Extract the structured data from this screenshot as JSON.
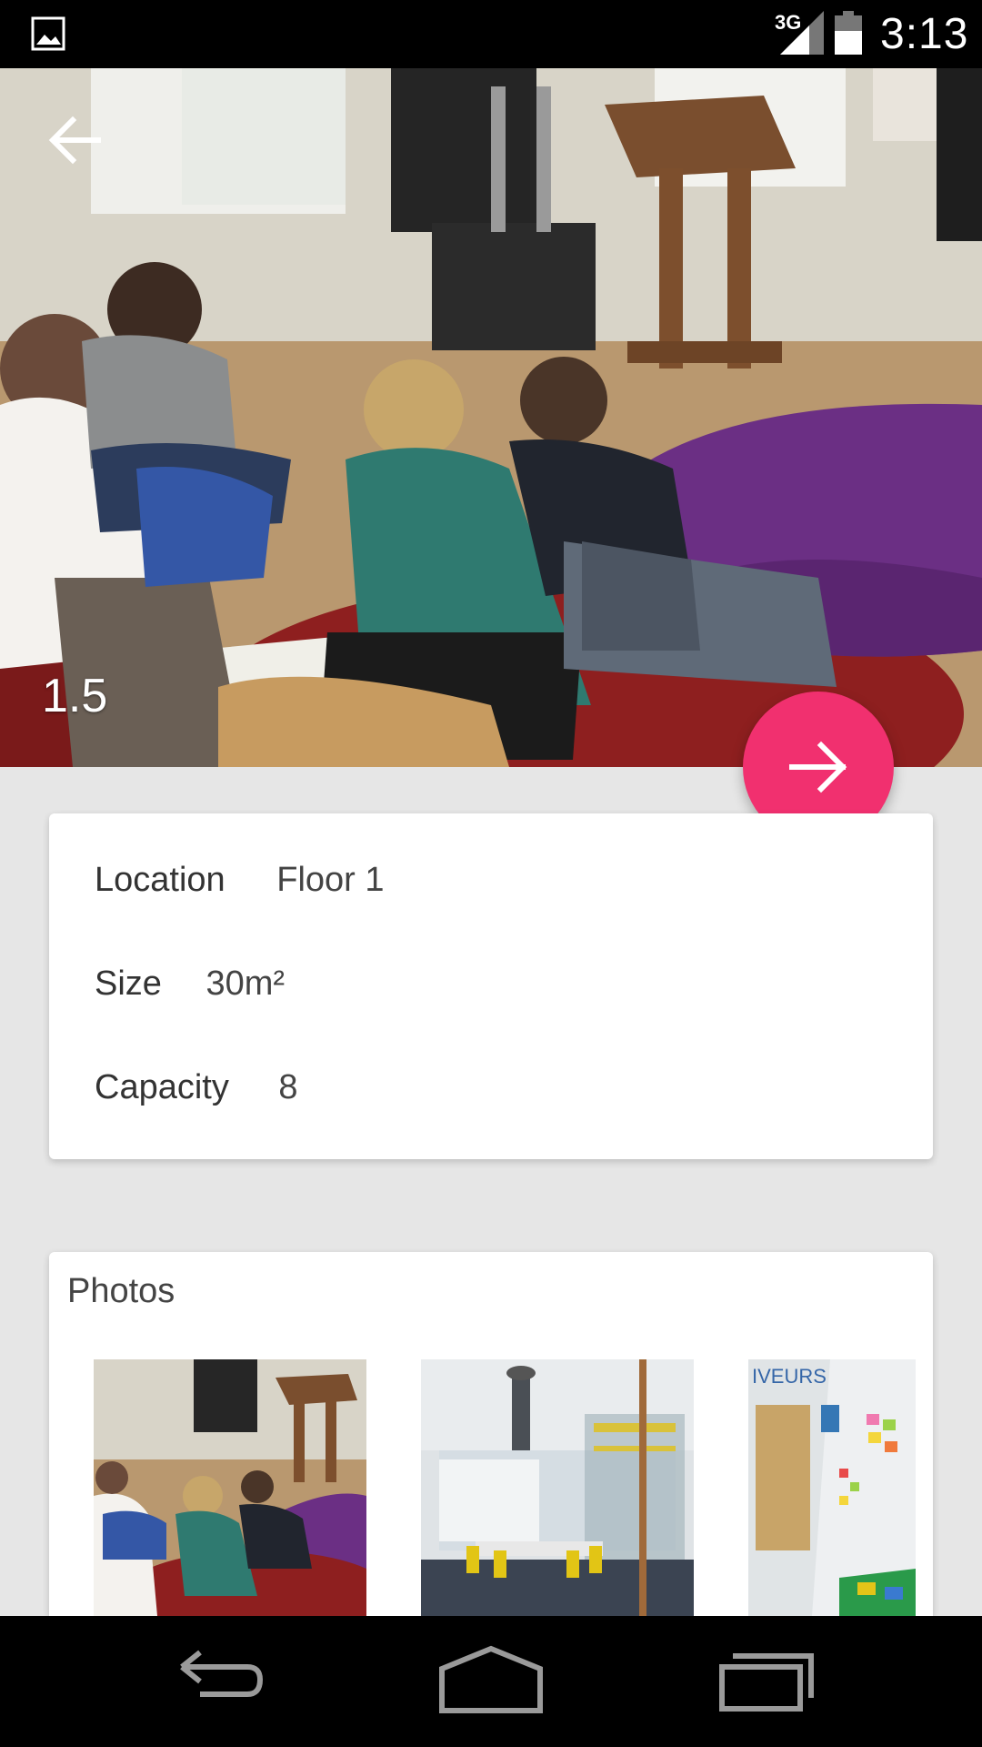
{
  "status_bar": {
    "network": "3G",
    "time": "3:13",
    "icons": [
      "gallery-icon",
      "signal-icon",
      "battery-icon"
    ]
  },
  "hero": {
    "rating": "1.5",
    "back_icon": "arrow-left-icon",
    "fab_icon": "arrow-right-icon",
    "fab_color": "#f1306f"
  },
  "details": {
    "location": {
      "label": "Location",
      "value": "Floor 1"
    },
    "size": {
      "label": "Size",
      "value": "30m²"
    },
    "capacity": {
      "label": "Capacity",
      "value": "8"
    }
  },
  "photos": {
    "title": "Photos",
    "items": [
      "workshop-photo",
      "conference-room-photo",
      "whiteboard-photo"
    ]
  },
  "nav": {
    "icons": [
      "back-icon",
      "home-icon",
      "recent-apps-icon"
    ]
  }
}
